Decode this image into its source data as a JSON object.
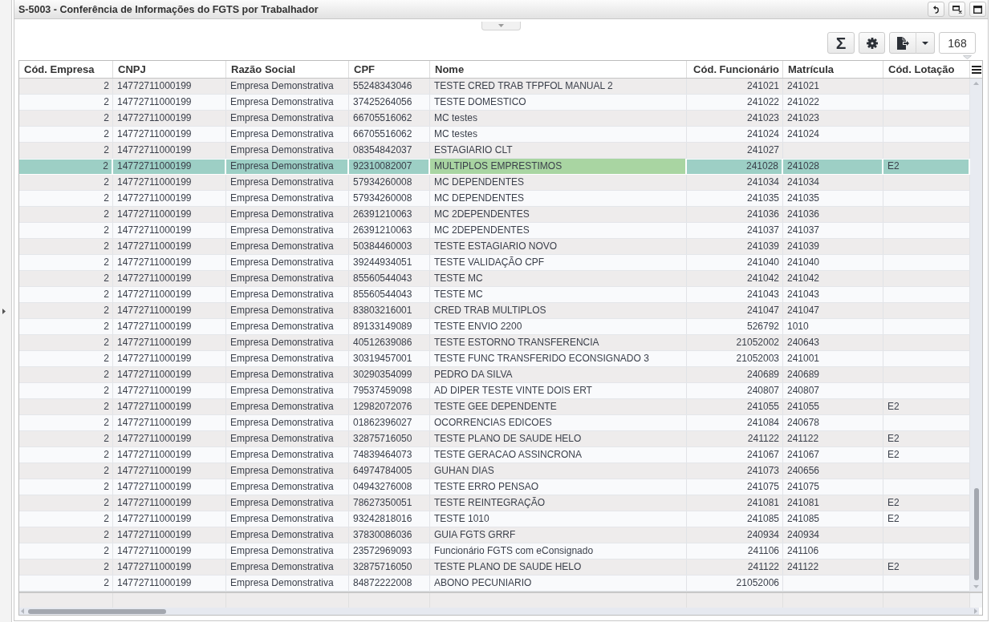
{
  "window": {
    "title": "S-5003 - Conferência de Informações do FGTS por Trabalhador"
  },
  "toolbar": {
    "sum_button": "Σ",
    "record_count": "168"
  },
  "table": {
    "columns": [
      {
        "label": "Cód. Empresa",
        "focused": false
      },
      {
        "label": "CNPJ",
        "focused": false
      },
      {
        "label": "Razão Social",
        "focused": false
      },
      {
        "label": "CPF",
        "focused": false
      },
      {
        "label": "Nome",
        "focused": true
      },
      {
        "label": "Cód. Funcionário",
        "focused": false
      },
      {
        "label": "Matrícula",
        "focused": false
      },
      {
        "label": "Cód. Lotação",
        "focused": false
      }
    ],
    "rows": [
      {
        "cells": [
          "2",
          "14772711000199",
          "Empresa Demonstrativa",
          "55248343046",
          "TESTE CRED TRAB TFPFOL MANUAL 2",
          "241021",
          "241021",
          null
        ],
        "selected": false
      },
      {
        "cells": [
          "2",
          "14772711000199",
          "Empresa Demonstrativa",
          "37425264056",
          "TESTE DOMESTICO",
          "241022",
          "241022",
          null
        ],
        "selected": false
      },
      {
        "cells": [
          "2",
          "14772711000199",
          "Empresa Demonstrativa",
          "66705516062",
          "MC testes",
          "241023",
          "241023",
          null
        ],
        "selected": false
      },
      {
        "cells": [
          "2",
          "14772711000199",
          "Empresa Demonstrativa",
          "66705516062",
          "MC testes",
          "241024",
          "241024",
          null
        ],
        "selected": false
      },
      {
        "cells": [
          "2",
          "14772711000199",
          "Empresa Demonstrativa",
          "08354842037",
          "ESTAGIARIO CLT",
          "241027",
          null,
          null
        ],
        "selected": false
      },
      {
        "cells": [
          "2",
          "14772711000199",
          "Empresa Demonstrativa",
          "92310082007",
          "MULTIPLOS EMPRESTIMOS",
          "241028",
          "241028",
          "E2"
        ],
        "selected": true
      },
      {
        "cells": [
          "2",
          "14772711000199",
          "Empresa Demonstrativa",
          "57934260008",
          "MC DEPENDENTES",
          "241034",
          "241034",
          null
        ],
        "selected": false
      },
      {
        "cells": [
          "2",
          "14772711000199",
          "Empresa Demonstrativa",
          "57934260008",
          "MC DEPENDENTES",
          "241035",
          "241035",
          null
        ],
        "selected": false
      },
      {
        "cells": [
          "2",
          "14772711000199",
          "Empresa Demonstrativa",
          "26391210063",
          "MC 2DEPENDENTES",
          "241036",
          "241036",
          null
        ],
        "selected": false
      },
      {
        "cells": [
          "2",
          "14772711000199",
          "Empresa Demonstrativa",
          "26391210063",
          "MC 2DEPENDENTES",
          "241037",
          "241037",
          null
        ],
        "selected": false
      },
      {
        "cells": [
          "2",
          "14772711000199",
          "Empresa Demonstrativa",
          "50384460003",
          "TESTE ESTAGIARIO NOVO",
          "241039",
          "241039",
          null
        ],
        "selected": false
      },
      {
        "cells": [
          "2",
          "14772711000199",
          "Empresa Demonstrativa",
          "39244934051",
          "TESTE VALIDAÇÃO CPF",
          "241040",
          "241040",
          null
        ],
        "selected": false
      },
      {
        "cells": [
          "2",
          "14772711000199",
          "Empresa Demonstrativa",
          "85560544043",
          "TESTE MC",
          "241042",
          "241042",
          null
        ],
        "selected": false
      },
      {
        "cells": [
          "2",
          "14772711000199",
          "Empresa Demonstrativa",
          "85560544043",
          "TESTE MC",
          "241043",
          "241043",
          null
        ],
        "selected": false
      },
      {
        "cells": [
          "2",
          "14772711000199",
          "Empresa Demonstrativa",
          "83803216001",
          "CRED TRAB MULTIPLOS",
          "241047",
          "241047",
          null
        ],
        "selected": false
      },
      {
        "cells": [
          "2",
          "14772711000199",
          "Empresa Demonstrativa",
          "89133149089",
          "TESTE ENVIO 2200",
          "526792",
          "1010",
          null
        ],
        "selected": false
      },
      {
        "cells": [
          "2",
          "14772711000199",
          "Empresa Demonstrativa",
          "40512639086",
          "TESTE ESTORNO TRANSFERENCIA",
          "21052002",
          "240643",
          null
        ],
        "selected": false
      },
      {
        "cells": [
          "2",
          "14772711000199",
          "Empresa Demonstrativa",
          "30319457001",
          "TESTE FUNC TRANSFERIDO ECONSIGNADO 3",
          "21052003",
          "241001",
          null
        ],
        "selected": false
      },
      {
        "cells": [
          "2",
          "14772711000199",
          "Empresa Demonstrativa",
          "30290354099",
          "PEDRO DA SILVA",
          "240689",
          "240689",
          null
        ],
        "selected": false
      },
      {
        "cells": [
          "2",
          "14772711000199",
          "Empresa Demonstrativa",
          "79537459098",
          "AD DIPER TESTE VINTE DOIS ERT",
          "240807",
          "240807",
          null
        ],
        "selected": false
      },
      {
        "cells": [
          "2",
          "14772711000199",
          "Empresa Demonstrativa",
          "12982072076",
          "TESTE GEE DEPENDENTE",
          "241055",
          "241055",
          "E2"
        ],
        "selected": false
      },
      {
        "cells": [
          "2",
          "14772711000199",
          "Empresa Demonstrativa",
          "01862396027",
          "OCORRENCIAS EDICOES",
          "241084",
          "240678",
          null
        ],
        "selected": false
      },
      {
        "cells": [
          "2",
          "14772711000199",
          "Empresa Demonstrativa",
          "32875716050",
          "TESTE PLANO DE SAUDE HELO",
          "241122",
          "241122",
          "E2"
        ],
        "selected": false
      },
      {
        "cells": [
          "2",
          "14772711000199",
          "Empresa Demonstrativa",
          "74839464073",
          "TESTE GERACAO ASSINCRONA",
          "241067",
          "241067",
          "E2"
        ],
        "selected": false
      },
      {
        "cells": [
          "2",
          "14772711000199",
          "Empresa Demonstrativa",
          "64974784005",
          "GUHAN DIAS",
          "241073",
          "240656",
          null
        ],
        "selected": false
      },
      {
        "cells": [
          "2",
          "14772711000199",
          "Empresa Demonstrativa",
          "04943276008",
          "TESTE ERRO PENSAO",
          "241075",
          "241075",
          null
        ],
        "selected": false
      },
      {
        "cells": [
          "2",
          "14772711000199",
          "Empresa Demonstrativa",
          "78627350051",
          "TESTE REINTEGRAÇÃO",
          "241081",
          "241081",
          "E2"
        ],
        "selected": false
      },
      {
        "cells": [
          "2",
          "14772711000199",
          "Empresa Demonstrativa",
          "93242818016",
          "TESTE 1010",
          "241085",
          "241085",
          "E2"
        ],
        "selected": false
      },
      {
        "cells": [
          "2",
          "14772711000199",
          "Empresa Demonstrativa",
          "37830086036",
          "GUIA FGTS GRRF",
          "240934",
          "240934",
          null
        ],
        "selected": false
      },
      {
        "cells": [
          "2",
          "14772711000199",
          "Empresa Demonstrativa",
          "23572969093",
          "Funcionário FGTS com eConsignado",
          "241106",
          "241106",
          null
        ],
        "selected": false
      },
      {
        "cells": [
          "2",
          "14772711000199",
          "Empresa Demonstrativa",
          "32875716050",
          "TESTE PLANO DE SAUDE HELO",
          "241122",
          "241122",
          "E2"
        ],
        "selected": false
      },
      {
        "cells": [
          "2",
          "14772711000199",
          "Empresa Demonstrativa",
          "84872222008",
          "ABONO PECUNIARIO",
          "21052006",
          null,
          null
        ],
        "selected": false
      }
    ]
  }
}
